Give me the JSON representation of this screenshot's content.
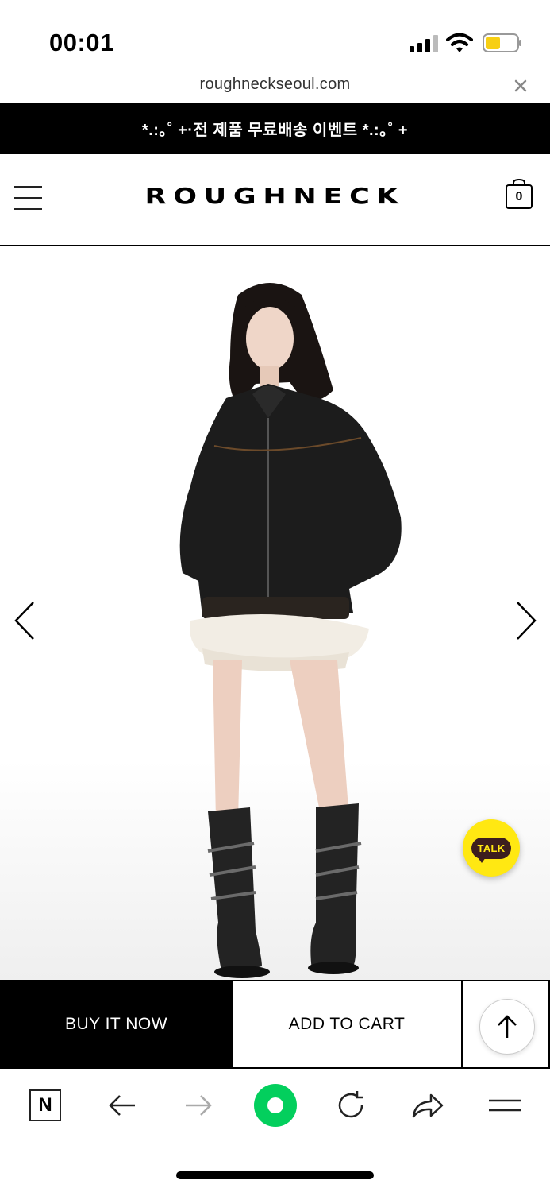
{
  "status_bar": {
    "time": "00:01"
  },
  "browser": {
    "url": "roughneckseoul.com"
  },
  "announcement": "*.:｡˚ +·전 제품 무료배송 이벤트 *.:｡˚ +",
  "header": {
    "logo": "ROUGHNECK",
    "cart_count": "0"
  },
  "product": {
    "chat_button_label": "TALK"
  },
  "actions": {
    "buy_now": "BUY IT NOW",
    "add_to_cart": "ADD TO CART"
  },
  "toolbar": {
    "naver_label": "N"
  },
  "colors": {
    "brand": "#000000",
    "kakao": "#ffe812",
    "naver_green": "#03cf5d"
  }
}
